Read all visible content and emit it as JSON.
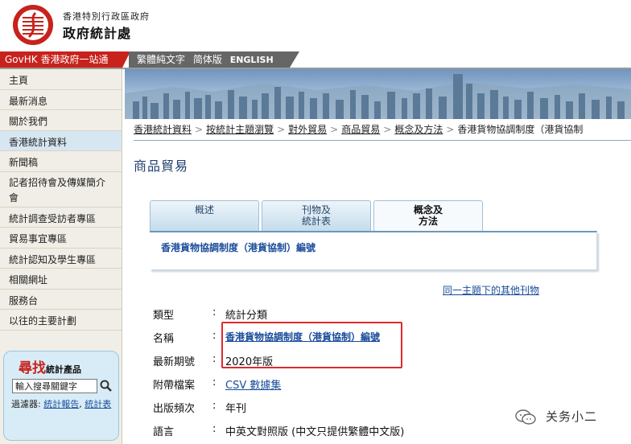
{
  "header": {
    "dept_line1": "香港特別行政區政府",
    "dept_line2": "政府統計處",
    "logo_icon": "census-statistics-logo-icon",
    "logo_color": "#c8221c"
  },
  "topbar": {
    "govhk": "GovHK 香港政府一站通",
    "lang_tc": "繁體純文字",
    "lang_sc": "简体版",
    "lang_en": "ENGLISH"
  },
  "sidebar": {
    "items": [
      {
        "label": "主頁"
      },
      {
        "label": "最新消息"
      },
      {
        "label": "關於我們"
      },
      {
        "label": "香港統計資料"
      },
      {
        "label": "新聞稿"
      },
      {
        "label": "記者招待會及傳媒簡介會"
      },
      {
        "label": "統計調查受訪者專區"
      },
      {
        "label": "貿易事宜專區"
      },
      {
        "label": "統計認知及學生專區"
      },
      {
        "label": "相關網址"
      },
      {
        "label": "服務台"
      },
      {
        "label": "以往的主要計劃"
      }
    ],
    "active_index": 3
  },
  "search": {
    "title_big": "尋找",
    "title_small": "統計產品",
    "placeholder": "輸入搜尋關鍵字",
    "value": "輸入搜尋關鍵字",
    "go_icon": "magnifier-icon",
    "filter_label": "過濾器:",
    "filter_opt1": "統計報告",
    "filter_sep": ",",
    "filter_opt2": "統計表"
  },
  "breadcrumb": {
    "items": [
      "香港統計資料",
      "按統計主題瀏覽",
      "對外貿易",
      "商品貿易",
      "概念及方法"
    ],
    "current": "香港貨物協調制度（港貨協制",
    "separator": ">"
  },
  "page_title": "商品貿易",
  "tabs": [
    {
      "label_1": "概述",
      "label_2": ""
    },
    {
      "label_1": "刊物及",
      "label_2": "統計表"
    },
    {
      "label_1": "概念及",
      "label_2": "方法"
    }
  ],
  "tab_panel_link": "香港貨物協調制度（港貨協制）編號",
  "other_pubs": "同一主題下的其他刊物",
  "details": {
    "colon": ":",
    "rows": [
      {
        "label": "類型",
        "value": "統計分類"
      },
      {
        "label": "名稱",
        "value": "香港貨物協調制度（港貨協制）編號"
      },
      {
        "label": "最新期號",
        "value": "2020年版"
      },
      {
        "label": "附帶檔案",
        "value": "CSV 數據集"
      },
      {
        "label": "出版頻次",
        "value": "年刊"
      },
      {
        "label": "語言",
        "value": "中英文對照版 (中文只提供繁體中文版)"
      }
    ]
  },
  "watermark": {
    "icon": "wechat-icon",
    "text": "关务小二"
  },
  "colors": {
    "govhk_red": "#c8221c",
    "link_blue": "#1a4c9a",
    "title_blue": "#1f3f6e",
    "highlight_red": "#e02a2a",
    "sidebar_bg": "#f0eee6",
    "sidebar_active": "#d6e7f2"
  }
}
